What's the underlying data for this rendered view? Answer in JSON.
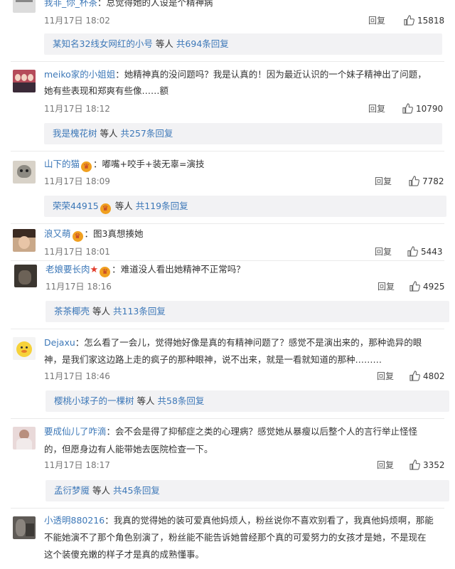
{
  "reply_label": "回复",
  "comments": [
    {
      "user": "我非_你_杯茶",
      "sep": "：",
      "text": "总觉得她的人设是个精神病",
      "time": "11月17日 18:02",
      "likes": "15818",
      "sub": {
        "name": "某知名32线女网红的小号",
        "mid": "等人",
        "count": "共694条回复"
      }
    },
    {
      "user": "meiko家的小姐姐",
      "sep": "：",
      "text": "她精神真的没问题吗？我是认真的！因为最近认识的一个妹子精神出了问题，",
      "text2": "她有些表现和郑爽有些像……额",
      "time": "11月17日 18:12",
      "likes": "10790",
      "sub": {
        "name": "我是槐花树",
        "mid": "等人",
        "count": "共257条回复"
      }
    },
    {
      "user": "山下的猫",
      "sep": "：",
      "text": "嘟嘴+咬手+装无辜=演技",
      "time": "11月17日 18:09",
      "likes": "7782",
      "sub": {
        "name": "荣荣44915",
        "mid": "等人",
        "count": "共119条回复"
      }
    },
    {
      "user": "浪又萌",
      "sep": "：",
      "text": "图3真想揍她",
      "time": "11月17日 18:01",
      "likes": "5443"
    },
    {
      "user": "老娘要长肉",
      "sep": "：",
      "text": "难道没人看出她精神不正常吗？",
      "time": "11月17日 18:16",
      "likes": "4925",
      "sub": {
        "name": "茶茶椰壳",
        "mid": "等人",
        "count": "共113条回复"
      }
    },
    {
      "user": "Dejaxu",
      "sep": "：",
      "text": "怎么看了一会儿，觉得她好像是真的有精神问题了？感觉不是演出来的，那种诡异的眼",
      "text2": "神，是我们家这边路上走的疯子的那种眼神，说不出来，就是一看就知道的那种………",
      "time": "11月17日 18:46",
      "likes": "4802",
      "sub": {
        "name": "樱桃小球子的一棵树",
        "mid": "等人",
        "count": "共58条回复"
      }
    },
    {
      "user": "要成仙儿了咋滴",
      "sep": "：",
      "text": "会不会是得了抑郁症之类的心理病？感觉她从暴瘦以后整个人的言行举止怪怪",
      "text2": "的，但愿身边有人能带她去医院检查一下。",
      "time": "11月17日 18:17",
      "likes": "3352",
      "sub": {
        "name": "孟衍梦魇",
        "mid": "等人",
        "count": "共45条回复"
      }
    },
    {
      "user": "小透明880216",
      "sep": "：",
      "text": "我真的觉得她的装可爱真他妈烦人，粉丝说你不喜欢别看了，我真他妈烦啊，那能",
      "text2": "不能她演不了那个角色别演了，粉丝能不能告诉她曾经那个真的可爱努力的女孩才是她，不是现在",
      "text3": "这个装傻充嫩的样子才是真的成熟懂事。"
    }
  ],
  "colors": {
    "link": "#3d78b8",
    "sub_bg": "#f2f2f4",
    "badge": "#f0a020"
  }
}
